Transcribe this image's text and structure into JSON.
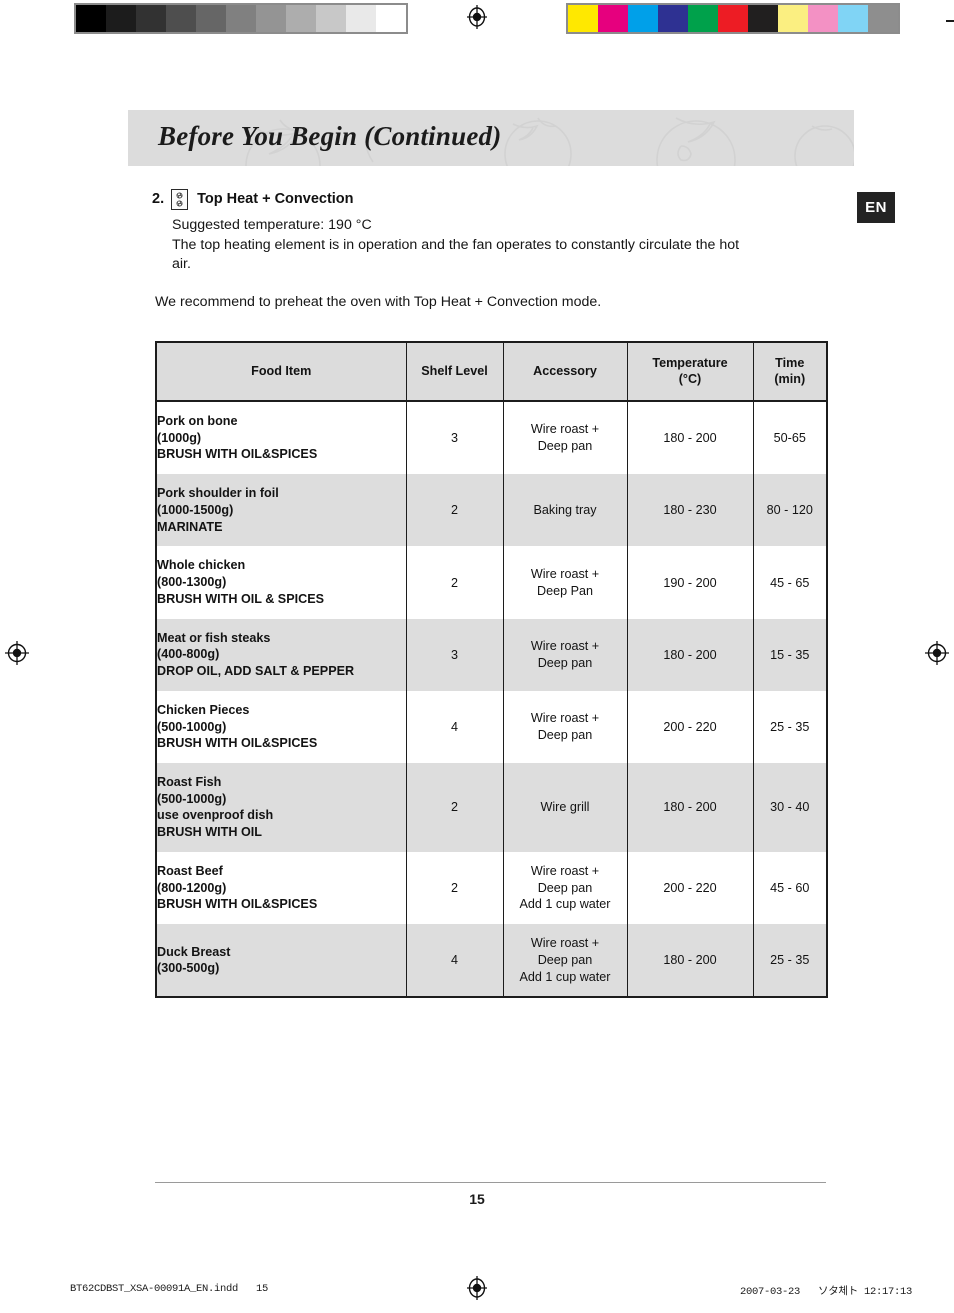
{
  "print_marks": {
    "grayscale_swatches": [
      "#000000",
      "#1c1c1c",
      "#323232",
      "#4e4e4e",
      "#666666",
      "#808080",
      "#949494",
      "#adadad",
      "#c8c8c8",
      "#e9e9e9",
      "#ffffff"
    ],
    "color_swatches": [
      "#ffe800",
      "#e6007e",
      "#00a0e9",
      "#2e3192",
      "#00a14b",
      "#ed1c24",
      "#211f1f",
      "#fbef81",
      "#f391c4",
      "#80d4f5",
      "#8e8e8e"
    ],
    "registration_icon": "registration-target-icon"
  },
  "header": {
    "title": "Before You Begin (Continued)",
    "background_color": "#dcdcdc"
  },
  "language_badge": {
    "label": "EN",
    "background_color": "#232323",
    "text_color": "#ffffff"
  },
  "intro": {
    "step_number": "2.",
    "mode_icon": "top-heat-convection-icon",
    "mode_title": "Top Heat + Convection",
    "line_1": "Suggested temperature: 190 °C",
    "line_2": "The top heating element is in operation and the fan operates to constantly circulate the hot",
    "line_3": "air.",
    "recommendation": "We recommend to preheat the oven with Top Heat  + Convection mode."
  },
  "table": {
    "headers": {
      "food": "Food Item",
      "shelf": "Shelf Level",
      "accessory": "Accessory",
      "temperature": "Temperature\n(°C)",
      "time": "Time\n(min)"
    },
    "rows": [
      {
        "food": "Pork on bone\n(1000g)\nBRUSH WITH OIL&SPICES",
        "shelf": "3",
        "accessory": "Wire roast +\nDeep pan",
        "temperature": "180 - 200",
        "time": "50-65"
      },
      {
        "food": "Pork shoulder in foil\n(1000-1500g)\nMARINATE",
        "shelf": "2",
        "accessory": "Baking tray",
        "temperature": "180 - 230",
        "time": "80 - 120"
      },
      {
        "food": "Whole chicken\n(800-1300g)\nBRUSH WITH OIL & SPICES",
        "shelf": "2",
        "accessory": "Wire roast +\nDeep Pan",
        "temperature": "190 - 200",
        "time": "45 - 65"
      },
      {
        "food": "Meat or fish steaks\n(400-800g)\nDROP OIL, ADD SALT & PEPPER",
        "shelf": "3",
        "accessory": "Wire roast +\nDeep pan",
        "temperature": "180 - 200",
        "time": "15 - 35"
      },
      {
        "food": "Chicken Pieces\n(500-1000g)\nBRUSH WITH OIL&SPICES",
        "shelf": "4",
        "accessory": "Wire roast +\nDeep pan",
        "temperature": "200 - 220",
        "time": "25 - 35"
      },
      {
        "food": "Roast Fish\n(500-1000g)\nuse ovenproof dish\nBRUSH WITH OIL",
        "shelf": "2",
        "accessory": "Wire grill",
        "temperature": "180 - 200",
        "time": "30 - 40"
      },
      {
        "food": "Roast Beef\n(800-1200g)\nBRUSH WITH OIL&SPICES",
        "shelf": "2",
        "accessory": "Wire roast +\nDeep pan\nAdd 1 cup water",
        "temperature": "200 - 220",
        "time": "45 - 60"
      },
      {
        "food": "Duck Breast\n(300-500g)",
        "shelf": "4",
        "accessory": "Wire roast +\nDeep pan\nAdd 1 cup water",
        "temperature": "180 - 200",
        "time": "25 - 35"
      }
    ]
  },
  "footer": {
    "page_number": "15",
    "print_left": "BT62CDBST_XSA-00091A_EN.indd   15",
    "print_right": "2007-03-23   ソタ체ト 12:17:13"
  }
}
